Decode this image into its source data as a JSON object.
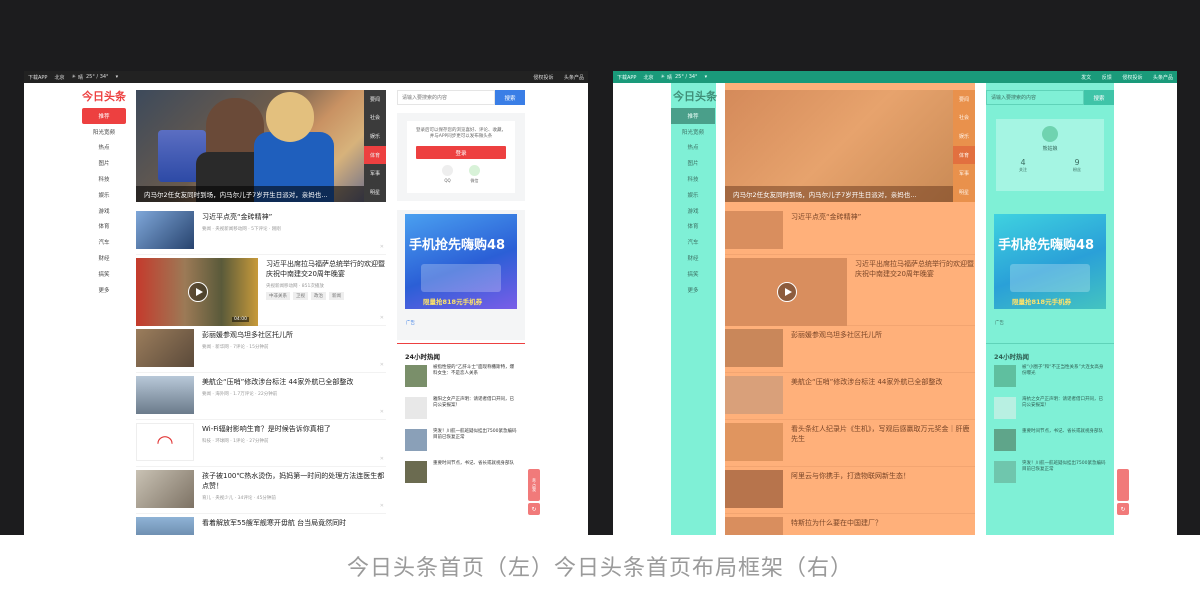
{
  "caption": "今日头条首页（左）今日头条首页布局框架（右）",
  "left": {
    "topbar": {
      "download": "下载APP",
      "city": "北京",
      "weather_icon": "sun-icon",
      "weather_word": "晴",
      "temp": "25° / 34°",
      "links": [
        "侵权投诉",
        "头条产品"
      ]
    },
    "logo": "今日头条",
    "nav": [
      "推荐",
      "阳光宽频",
      "热点",
      "图片",
      "科技",
      "娱乐",
      "游戏",
      "体育",
      "汽车",
      "财经",
      "搞笑",
      "更多"
    ],
    "hero": {
      "caption": "内马尔2任女友同时到场，内马尔儿子7岁开生日派对，亲妈也…",
      "tabs": [
        "要闻",
        "社会",
        "娱乐",
        "体育",
        "军事",
        "明星"
      ],
      "active_tab": 3
    },
    "feed": [
      {
        "title": "习近平点亮“金砖精神”",
        "badge": "要闻",
        "source": "央视新闻移动网",
        "comments": "5下评论",
        "time": "刚刚"
      },
      {
        "title": "习近平出席拉马福萨总统举行的欢迎暨庆祝中南建交20周年晚宴",
        "source": "央视新闻移动网",
        "views": "851次播放",
        "tags": [
          "中非关系",
          "卫视",
          "政治",
          "新闻"
        ],
        "duration": "04:00"
      },
      {
        "title": "彭丽媛参观乌坦多社区托儿所",
        "badge": "要闻",
        "source": "新华网",
        "comments": "7评论",
        "time": "15分钟前"
      },
      {
        "title": "美航企“压哨”修改涉台标注 44家外航已全部整改",
        "badge": "要闻",
        "source": "海外网",
        "comments": "1.7万评论",
        "time": "22分钟前"
      },
      {
        "title": "Wi-Fi辐射影响生育？是时候告诉你真相了",
        "badge": "科技",
        "source": "环球网",
        "comments": "1评论",
        "time": "27分钟前"
      },
      {
        "title": "孩子被100℃热水烫伤，妈妈第一时间的处理方法连医生都点赞！",
        "badge": "育儿",
        "source": "央视少儿",
        "comments": "34评论",
        "time": "45分钟前"
      },
      {
        "title": "看着解放军55艘军舰寒开毋航 台当局竟然同时"
      }
    ],
    "search": {
      "placeholder": "请输入要搜索的内容",
      "button": "搜索"
    },
    "login": {
      "desc_line1": "登录后可以保存您的浏览喜好、评论、收藏，",
      "desc_line2": "并与APP同步更可以发布微头条",
      "button": "登录",
      "qq": "QQ",
      "wechat": "微信"
    },
    "ad": {
      "headline": "手机抢先嗨购48",
      "sub": "限量抢818元手机券",
      "label": "广告"
    },
    "hot": {
      "title": "24小时热闻",
      "items": [
        "被指性侵的“乙肝斗士”面现称撒斯特，爆料女生：不是恋人关系",
        "雅阳之女产正声明：请谣者借口开同，已向公安报案！",
        "突发！川航一航班疑似挂出7500紧急编码 目前已恢复正常",
        "重要时间节点，书记、省长或就视身部队"
      ]
    },
    "float_label": "亲·点我"
  },
  "right": {
    "topbar": {
      "download": "下载APP",
      "city": "北京",
      "weather_icon": "sun-icon",
      "weather_word": "晴",
      "temp": "25° / 34°",
      "links": [
        "发文",
        "反馈",
        "侵权投诉",
        "头条产品"
      ]
    },
    "logo": "今日头条",
    "nav": [
      "推荐",
      "阳光宽频",
      "热点",
      "图片",
      "科技",
      "娱乐",
      "游戏",
      "体育",
      "汽车",
      "财经",
      "搞笑",
      "更多"
    ],
    "hero_caption": "内马尔2任女友同时到场，内马尔儿子7岁开生日派对，亲妈也…",
    "hero_tabs": [
      "要闻",
      "社会",
      "娱乐",
      "体育",
      "军事",
      "明星"
    ],
    "feed": [
      "习近平点亮“金砖精神”",
      "习近平出席拉马福萨总统举行的欢迎暨庆祝中南建交20周年晚宴",
      "彭丽媛参观乌坦多社区托儿所",
      "美航企“压哨”修改涉台标注 44家外航已全部整改",
      "看头条红人纪录片《生机》，写观后感赢取万元奖金｜肝鹿先生",
      "阿里云与你携手，打造物联网新生态！",
      "特斯拉为什么要在中国建厂？"
    ],
    "search": {
      "placeholder": "请输入要搜索的内容",
      "button": "搜索"
    },
    "profile": {
      "name": "熊姑娘",
      "count1": "4",
      "count1_label": "关注",
      "count2": "9",
      "count2_label": "粉丝"
    },
    "ad": {
      "headline": "手机抢先嗨购48",
      "sub": "限量抢818元手机券",
      "label": "广告"
    },
    "hot": {
      "title": "24小时热闻",
      "items": [
        "被“小圈子”和“不正当性关系”大连女高身份曝光",
        "海抗之女产正声明：请谣者借口开同，已向公安报案！",
        "重要时间节点，书记、省长或就视身部队",
        "突发！川航一航班疑似挂出7500紧急编码 目前已恢复正常"
      ]
    }
  }
}
